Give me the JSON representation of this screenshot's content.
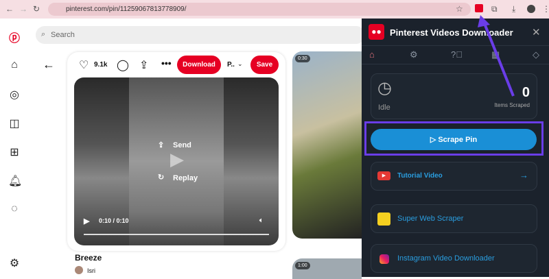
{
  "browser": {
    "url": "pinterest.com/pin/1125906781377​8909/"
  },
  "pinterest": {
    "search_placeholder": "Search",
    "likes": "9.1k",
    "download_label": "Download",
    "board": "P..",
    "save_label": "Save",
    "send_label": "Send",
    "replay_label": "Replay",
    "time": "0:10 / 0:10",
    "title": "Breeze",
    "user": "Isri",
    "badge1": "0:30",
    "badge2": "1:00"
  },
  "extension": {
    "title": "Pinterest Videos Downloader",
    "status": "Idle",
    "count": "0",
    "count_label": "Items Scraped",
    "scrape_label": "Scrape Pin",
    "tutorial_label": "Tutorial Video",
    "super_label": "Super Web Scraper",
    "insta_label": "Instagram Video Downloader"
  },
  "colors": {
    "pinterest_red": "#e60023",
    "scrape_blue": "#1a8fd6",
    "highlight": "#6a3de8",
    "panel_bg": "#1b222c"
  }
}
